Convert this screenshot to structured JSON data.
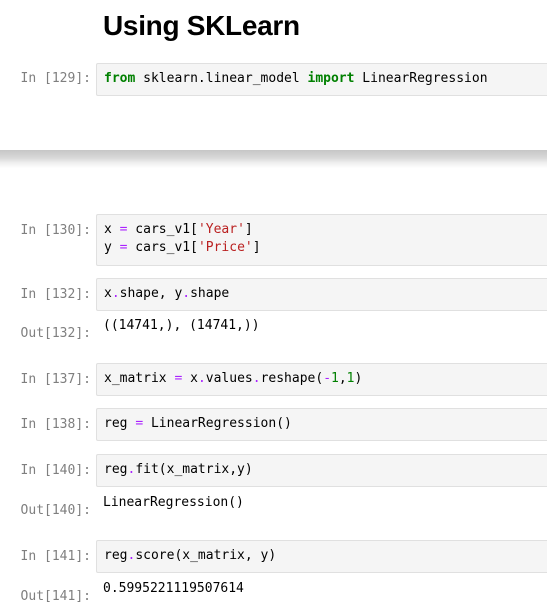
{
  "heading": "Using SKLearn",
  "cells": [
    {
      "in_prompt": "In [129]:",
      "lines": [
        [
          [
            "kw",
            "from"
          ],
          [
            "p",
            " sklearn.linear_model "
          ],
          [
            "kw",
            "import"
          ],
          [
            "p",
            " LinearRegression"
          ]
        ]
      ]
    },
    {
      "in_prompt": "In [130]:",
      "lines": [
        [
          [
            "p",
            "x "
          ],
          [
            "op",
            "="
          ],
          [
            "p",
            " cars_v1["
          ],
          [
            "str",
            "'Year'"
          ],
          [
            "p",
            "]"
          ]
        ],
        [
          [
            "p",
            "y "
          ],
          [
            "op",
            "="
          ],
          [
            "p",
            " cars_v1["
          ],
          [
            "str",
            "'Price'"
          ],
          [
            "p",
            "]"
          ]
        ]
      ]
    },
    {
      "in_prompt": "In [132]:",
      "lines": [
        [
          [
            "p",
            "x"
          ],
          [
            "op",
            "."
          ],
          [
            "p",
            "shape, y"
          ],
          [
            "op",
            "."
          ],
          [
            "p",
            "shape"
          ]
        ]
      ],
      "out_prompt": "Out[132]:",
      "output": "((14741,), (14741,))"
    },
    {
      "in_prompt": "In [137]:",
      "lines": [
        [
          [
            "p",
            "x_matrix "
          ],
          [
            "op",
            "="
          ],
          [
            "p",
            " x"
          ],
          [
            "op",
            "."
          ],
          [
            "p",
            "values"
          ],
          [
            "op",
            "."
          ],
          [
            "p",
            "reshape("
          ],
          [
            "op",
            "-"
          ],
          [
            "num",
            "1"
          ],
          [
            "p",
            ","
          ],
          [
            "num",
            "1"
          ],
          [
            "p",
            ")"
          ]
        ]
      ]
    },
    {
      "in_prompt": "In [138]:",
      "lines": [
        [
          [
            "p",
            "reg "
          ],
          [
            "op",
            "="
          ],
          [
            "p",
            " LinearRegression()"
          ]
        ]
      ]
    },
    {
      "in_prompt": "In [140]:",
      "lines": [
        [
          [
            "p",
            "reg"
          ],
          [
            "op",
            "."
          ],
          [
            "p",
            "fit(x_matrix,y)"
          ]
        ]
      ],
      "out_prompt": "Out[140]:",
      "output": "LinearRegression()"
    },
    {
      "in_prompt": "In [141]:",
      "lines": [
        [
          [
            "p",
            "reg"
          ],
          [
            "op",
            "."
          ],
          [
            "p",
            "score(x_matrix, y)"
          ]
        ]
      ],
      "out_prompt": "Out[141]:",
      "output": "0.5995221119507614"
    }
  ]
}
